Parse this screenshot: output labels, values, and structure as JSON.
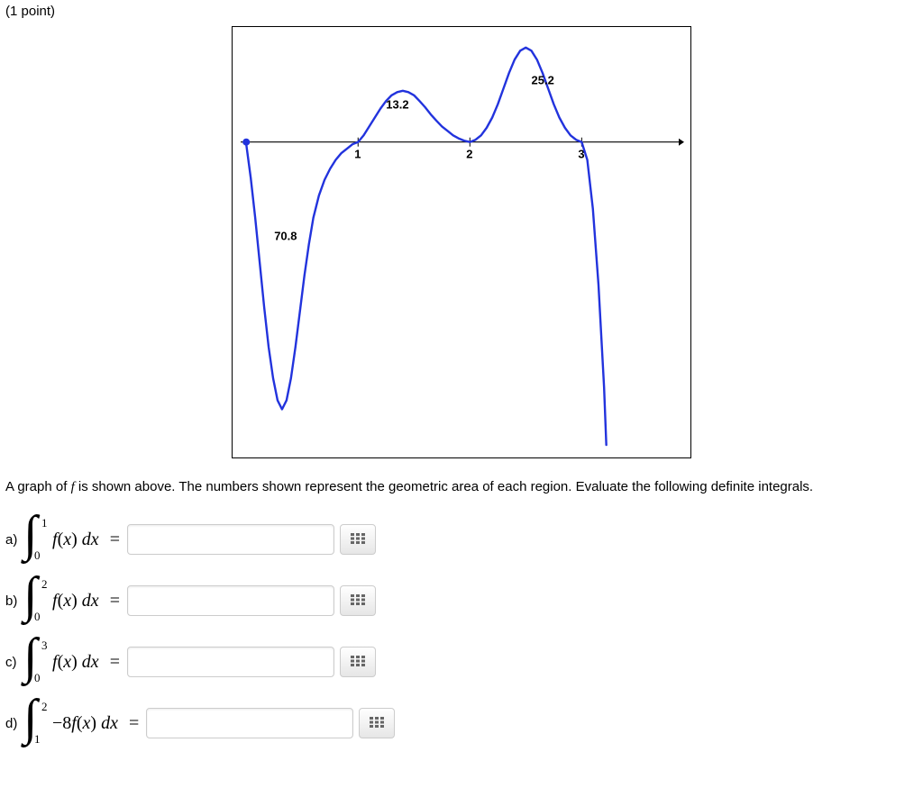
{
  "points_label": "(1 point)",
  "prompt_before": "A graph of ",
  "prompt_f": "f",
  "prompt_after": " is shown above. The numbers shown represent the geometric area of each region. Evaluate the following definite integrals.",
  "chart_data": {
    "type": "line",
    "title": "",
    "xlabel": "",
    "ylabel": "",
    "x_ticks": [
      1,
      2,
      3
    ],
    "annotations": [
      {
        "text": "70.8",
        "region": "below_axis_0_to_1",
        "x": 0.25,
        "y": -2.2
      },
      {
        "text": "13.2",
        "region": "above_axis_1_to_2",
        "x": 1.25,
        "y": 0.75
      },
      {
        "text": "25.2",
        "region": "above_axis_2_to_3",
        "x": 2.55,
        "y": 1.3
      }
    ],
    "regions": [
      {
        "from": 0,
        "to": 1,
        "signed_area": -70.8
      },
      {
        "from": 1,
        "to": 2,
        "signed_area": 13.2
      },
      {
        "from": 2,
        "to": 3,
        "signed_area": 25.2
      }
    ],
    "curve_sample": [
      [
        0.0,
        -0.05
      ],
      [
        0.04,
        -0.8
      ],
      [
        0.08,
        -1.7
      ],
      [
        0.12,
        -2.7
      ],
      [
        0.16,
        -3.7
      ],
      [
        0.2,
        -4.6
      ],
      [
        0.24,
        -5.3
      ],
      [
        0.28,
        -5.8
      ],
      [
        0.32,
        -6.0
      ],
      [
        0.36,
        -5.8
      ],
      [
        0.4,
        -5.3
      ],
      [
        0.44,
        -4.6
      ],
      [
        0.48,
        -3.8
      ],
      [
        0.52,
        -3.0
      ],
      [
        0.56,
        -2.3
      ],
      [
        0.6,
        -1.7
      ],
      [
        0.65,
        -1.2
      ],
      [
        0.7,
        -0.85
      ],
      [
        0.75,
        -0.6
      ],
      [
        0.8,
        -0.4
      ],
      [
        0.85,
        -0.25
      ],
      [
        0.9,
        -0.15
      ],
      [
        0.95,
        -0.05
      ],
      [
        1.0,
        0.0
      ],
      [
        1.05,
        0.15
      ],
      [
        1.1,
        0.35
      ],
      [
        1.15,
        0.55
      ],
      [
        1.2,
        0.75
      ],
      [
        1.25,
        0.92
      ],
      [
        1.3,
        1.05
      ],
      [
        1.35,
        1.12
      ],
      [
        1.4,
        1.15
      ],
      [
        1.45,
        1.12
      ],
      [
        1.5,
        1.05
      ],
      [
        1.55,
        0.92
      ],
      [
        1.6,
        0.78
      ],
      [
        1.65,
        0.62
      ],
      [
        1.7,
        0.48
      ],
      [
        1.75,
        0.35
      ],
      [
        1.8,
        0.25
      ],
      [
        1.85,
        0.15
      ],
      [
        1.9,
        0.08
      ],
      [
        1.95,
        0.03
      ],
      [
        2.0,
        0.0
      ],
      [
        2.05,
        0.05
      ],
      [
        2.1,
        0.15
      ],
      [
        2.15,
        0.32
      ],
      [
        2.2,
        0.55
      ],
      [
        2.25,
        0.85
      ],
      [
        2.3,
        1.2
      ],
      [
        2.35,
        1.55
      ],
      [
        2.4,
        1.85
      ],
      [
        2.45,
        2.05
      ],
      [
        2.5,
        2.12
      ],
      [
        2.55,
        2.05
      ],
      [
        2.6,
        1.85
      ],
      [
        2.65,
        1.55
      ],
      [
        2.7,
        1.2
      ],
      [
        2.75,
        0.85
      ],
      [
        2.8,
        0.55
      ],
      [
        2.85,
        0.32
      ],
      [
        2.9,
        0.15
      ],
      [
        2.95,
        0.05
      ],
      [
        3.0,
        0.0
      ],
      [
        3.05,
        -0.4
      ],
      [
        3.1,
        -1.5
      ],
      [
        3.15,
        -3.2
      ],
      [
        3.2,
        -5.5
      ],
      [
        3.22,
        -6.8
      ]
    ],
    "xlim": [
      -0.05,
      3.9
    ],
    "ylim": [
      -6.9,
      2.4
    ]
  },
  "questions": [
    {
      "label": "a)",
      "lower": "0",
      "upper": "1",
      "coef": "",
      "value": ""
    },
    {
      "label": "b)",
      "lower": "0",
      "upper": "2",
      "coef": "",
      "value": ""
    },
    {
      "label": "c)",
      "lower": "0",
      "upper": "3",
      "coef": "",
      "value": ""
    },
    {
      "label": "d)",
      "lower": "1",
      "upper": "2",
      "coef": "−8",
      "value": ""
    }
  ]
}
